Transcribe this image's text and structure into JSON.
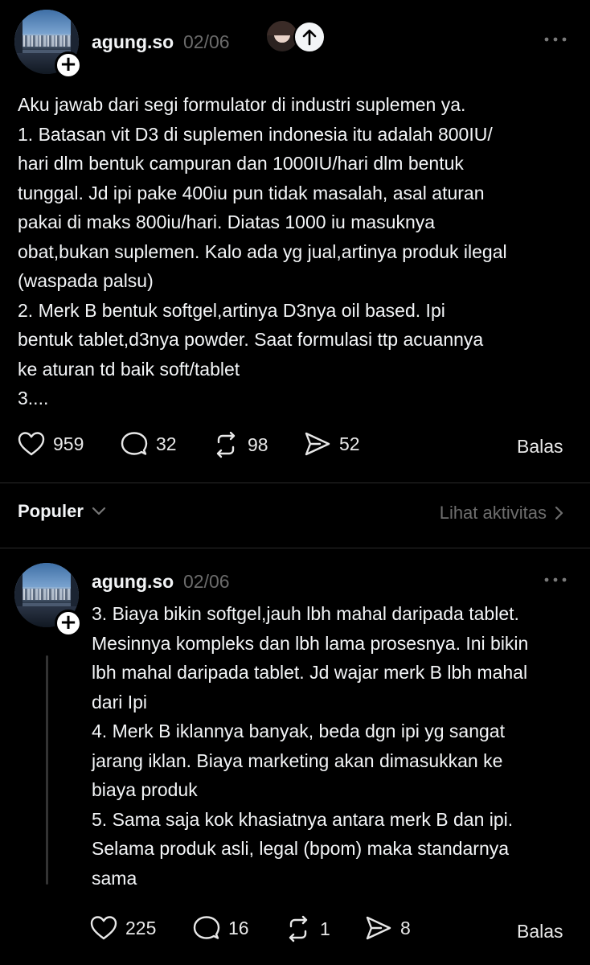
{
  "post1": {
    "username": "agung.so",
    "date": "02/06",
    "more_icon": "more-dots-icon",
    "text": "Aku jawab dari segi formulator di industri suplemen ya.\n1. Batasan vit D3 di suplemen indonesia itu adalah 800IU/\nhari dlm bentuk campuran dan 1000IU/hari dlm bentuk\ntunggal. Jd ipi pake 400iu pun tidak masalah, asal aturan\npakai di maks 800iu/hari. Diatas 1000 iu masuknya\nobat,bukan suplemen. Kalo ada yg jual,artinya produk ilegal\n(waspada palsu)\n2. Merk B bentuk softgel,artinya D3nya oil based. Ipi\nbentuk tablet,d3nya powder. Saat formulasi ttp acuannya\nke aturan td baik soft/tablet\n3....",
    "likes": "959",
    "comments": "32",
    "reposts": "98",
    "shares": "52",
    "reply_label": "Balas"
  },
  "sort": {
    "label": "Populer",
    "activity_link": "Lihat aktivitas"
  },
  "post2": {
    "username": "agung.so",
    "date": "02/06",
    "more_icon": "more-dots-icon",
    "text": "3. Biaya bikin softgel,jauh lbh mahal daripada tablet.\nMesinnya kompleks dan lbh lama prosesnya. Ini bikin\nlbh mahal daripada tablet. Jd wajar merk B lbh mahal\ndari Ipi\n4. Merk B iklannya banyak, beda dgn ipi yg sangat\njarang iklan. Biaya marketing akan dimasukkan ke\nbiaya produk\n5. Sama saja kok khasiatnya antara merk B dan ipi.\nSelama produk asli, legal (bpom) maka standarnya\nsama",
    "likes": "225",
    "comments": "16",
    "reposts": "1",
    "shares": "8",
    "reply_label": "Balas"
  },
  "colors": {
    "background": "#000000",
    "text": "#f3f5f7",
    "muted": "#6b6b6b"
  }
}
